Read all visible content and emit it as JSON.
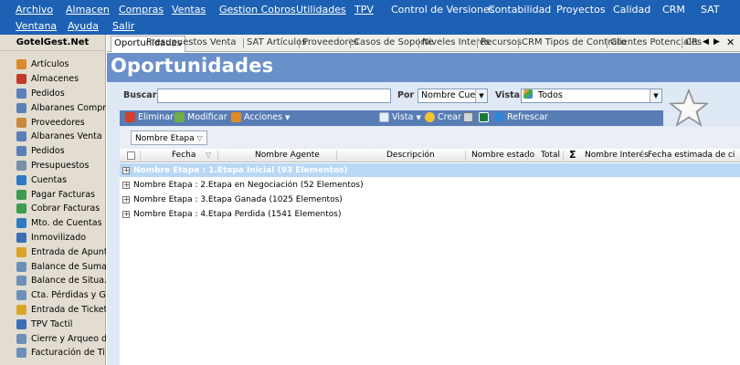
{
  "menu": {
    "row1": [
      "Archivo",
      "Almacen",
      "Compras",
      "Ventas",
      "Gestion Cobros",
      "Utilidades",
      "TPV",
      "Control de Versiones",
      "Contabilidad",
      "Proyectos",
      "Calidad",
      "CRM",
      "SAT"
    ],
    "row2": [
      "Ventana",
      "Ayuda",
      "Salir"
    ]
  },
  "sidebar": {
    "title": "GotelGest.Net",
    "items": [
      {
        "label": "Artículos",
        "color": "#d98a2b"
      },
      {
        "label": "Almacenes",
        "color": "#c0392b"
      },
      {
        "label": "Pedidos",
        "color": "#5d7fb8"
      },
      {
        "label": "Albaranes Compra",
        "color": "#5d7fb8"
      },
      {
        "label": "Proveedores",
        "color": "#c98a3e"
      },
      {
        "label": "Albaranes Venta",
        "color": "#5d7fb8"
      },
      {
        "label": "Pedidos",
        "color": "#5d7fb8"
      },
      {
        "label": "Presupuestos",
        "color": "#7a8fa8"
      },
      {
        "label": "Cuentas",
        "color": "#2e7bc4"
      },
      {
        "label": "Pagar Facturas",
        "color": "#3e9b4f"
      },
      {
        "label": "Cobrar Facturas",
        "color": "#3e9b4f"
      },
      {
        "label": "Mto. de Cuentas",
        "color": "#2e7bc4"
      },
      {
        "label": "Inmovilizado",
        "color": "#3a6fb8"
      },
      {
        "label": "Entrada de Apunt...",
        "color": "#d9a52b"
      },
      {
        "label": "Balance de Suma...",
        "color": "#6f8fb8"
      },
      {
        "label": "Balance de Situa...",
        "color": "#6f8fb8"
      },
      {
        "label": "Cta. Pérdidas y G...",
        "color": "#6f8fb8"
      },
      {
        "label": "Entrada de Tickets",
        "color": "#d9a52b"
      },
      {
        "label": "TPV Tactil",
        "color": "#3a6fb8"
      },
      {
        "label": "Cierre y Arqueo d...",
        "color": "#6f8fb8"
      },
      {
        "label": "Facturación de Ti...",
        "color": "#6f8fb8"
      }
    ]
  },
  "tabs": [
    "Oportunidades",
    "Presupuestos Venta",
    "SAT Artículos",
    "Proveedores",
    "Casos de Soporte",
    "Niveles Interés",
    "Recursos",
    "CRM Tipos de Contrato",
    "Clientes Potenciales",
    "CRM"
  ],
  "tab_nav": [
    "◀",
    "▶",
    "✕"
  ],
  "page_title": "Oportunidades",
  "search": {
    "buscar_label": "Buscar",
    "value": "",
    "por_label": "Por",
    "por_value": "Nombre Cuenta",
    "vista_label": "Vista",
    "vista_value": "Todos"
  },
  "toolbar": {
    "eliminar": "Eliminar",
    "modificar": "Modificar",
    "acciones": "Acciones",
    "vista": "Vista",
    "crear": "Crear",
    "refrescar": "Refrescar"
  },
  "group_chip": "Nombre Etapa",
  "columns": [
    "Fecha",
    "Nombre Agente",
    "Descripción",
    "Nombre estado",
    "Total",
    "Nombre Interés",
    "Fecha estimada de ci"
  ],
  "groups": [
    "Nombre Etapa : 1.Etapa Inicial (93 Elementos)",
    "Nombre Etapa : 2.Etapa en Negociación (52 Elementos)",
    "Nombre Etapa : 3.Etapa Ganada (1025 Elementos)",
    "Nombre Etapa : 4.Etapa Perdida (1541 Elementos)"
  ],
  "colors": {
    "menubar": "#1d61b4",
    "header": "#6a90c9",
    "toolbar": "#587db5",
    "selected_row": "#b9d8f6"
  }
}
